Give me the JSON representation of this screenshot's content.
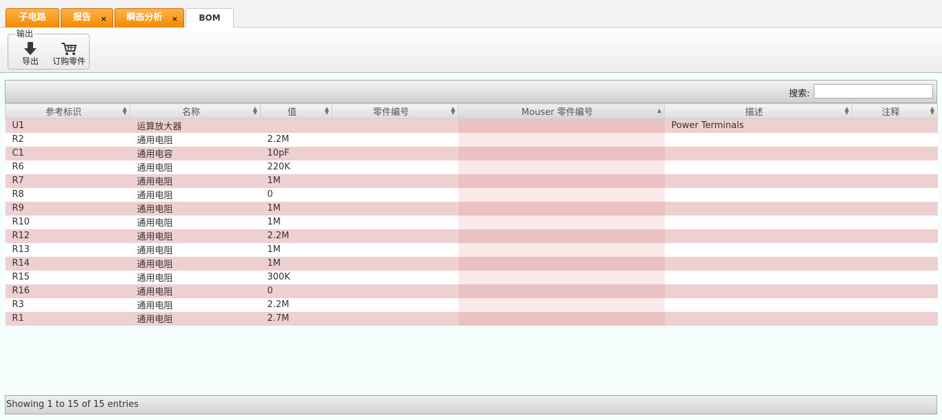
{
  "tabs": [
    {
      "label": "子电路",
      "closable": false
    },
    {
      "label": "报告",
      "closable": true
    },
    {
      "label": "瞬态分析",
      "closable": true
    },
    {
      "label": "BOM",
      "closable": false,
      "active": true
    }
  ],
  "close_glyph": "×",
  "ribbon": {
    "group_title": "输出",
    "buttons": [
      {
        "label": "导出",
        "icon": "download-arrow-icon"
      },
      {
        "label": "订购零件",
        "icon": "shopping-cart-icon"
      }
    ]
  },
  "search": {
    "label": "搜索:",
    "value": ""
  },
  "table": {
    "columns": [
      "参考标识",
      "名称",
      "值",
      "零件编号",
      "Mouser 零件编号",
      "描述",
      "注释"
    ],
    "sorted_column": 4,
    "rows": [
      [
        "U1",
        "运算放大器",
        "",
        "",
        "",
        "Power Terminals",
        ""
      ],
      [
        "R2",
        "通用电阻",
        "2.2M",
        "",
        "",
        "",
        ""
      ],
      [
        "C1",
        "通用电容",
        "10pF",
        "",
        "",
        "",
        ""
      ],
      [
        "R6",
        "通用电阻",
        "220K",
        "",
        "",
        "",
        ""
      ],
      [
        "R7",
        "通用电阻",
        "1M",
        "",
        "",
        "",
        ""
      ],
      [
        "R8",
        "通用电阻",
        "0",
        "",
        "",
        "",
        ""
      ],
      [
        "R9",
        "通用电阻",
        "1M",
        "",
        "",
        "",
        ""
      ],
      [
        "R10",
        "通用电阻",
        "1M",
        "",
        "",
        "",
        ""
      ],
      [
        "R12",
        "通用电阻",
        "2.2M",
        "",
        "",
        "",
        ""
      ],
      [
        "R13",
        "通用电阻",
        "1M",
        "",
        "",
        "",
        ""
      ],
      [
        "R14",
        "通用电阻",
        "1M",
        "",
        "",
        "",
        ""
      ],
      [
        "R15",
        "通用电阻",
        "300K",
        "",
        "",
        "",
        ""
      ],
      [
        "R16",
        "通用电阻",
        "0",
        "",
        "",
        "",
        ""
      ],
      [
        "R3",
        "通用电阻",
        "2.2M",
        "",
        "",
        "",
        ""
      ],
      [
        "R1",
        "通用电阻",
        "2.7M",
        "",
        "",
        "",
        ""
      ]
    ]
  },
  "footer": {
    "info": "Showing 1 to 15 of 15 entries"
  },
  "colors": {
    "tab_orange": "#f28a00",
    "row_odd": "#efd0d0",
    "row_even": "#ffffff"
  }
}
